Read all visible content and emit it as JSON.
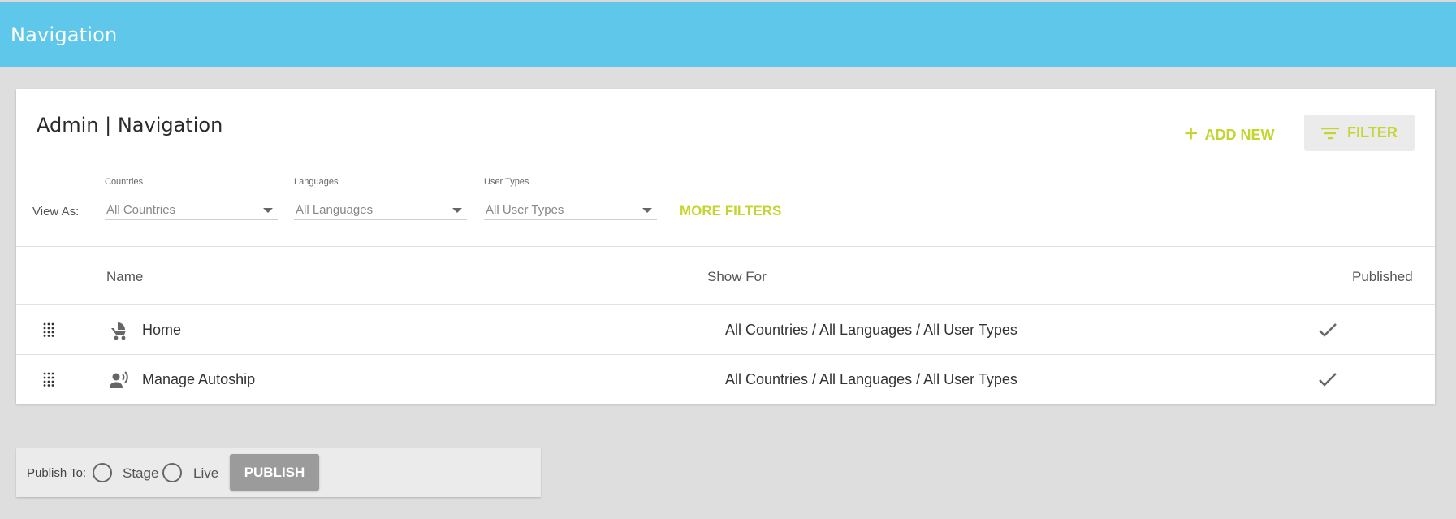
{
  "header": {
    "title": "Navigation"
  },
  "card": {
    "title": "Admin | Navigation",
    "add_new_label": "ADD NEW",
    "filter_label": "FILTER",
    "view_as_label": "View As:",
    "filters": {
      "countries": {
        "label": "Countries",
        "value": "All Countries"
      },
      "languages": {
        "label": "Languages",
        "value": "All Languages"
      },
      "user_types": {
        "label": "User Types",
        "value": "All User Types"
      }
    },
    "more_filters_label": "MORE FILTERS"
  },
  "table": {
    "columns": {
      "name": "Name",
      "show_for": "Show For",
      "published": "Published"
    },
    "rows": [
      {
        "icon": "stroller-icon",
        "name": "Home",
        "show_for": "All Countries / All Languages / All User Types",
        "published": true
      },
      {
        "icon": "person-voice-icon",
        "name": "Manage Autoship",
        "show_for": "All Countries / All Languages / All User Types",
        "published": true
      }
    ]
  },
  "publish": {
    "label": "Publish To:",
    "options": [
      "Stage",
      "Live"
    ],
    "button_label": "PUBLISH"
  },
  "colors": {
    "header_bg": "#5fc8ea",
    "accent": "#c5d530",
    "page_bg": "#dedede",
    "publish_button": "#9b9b9b"
  }
}
